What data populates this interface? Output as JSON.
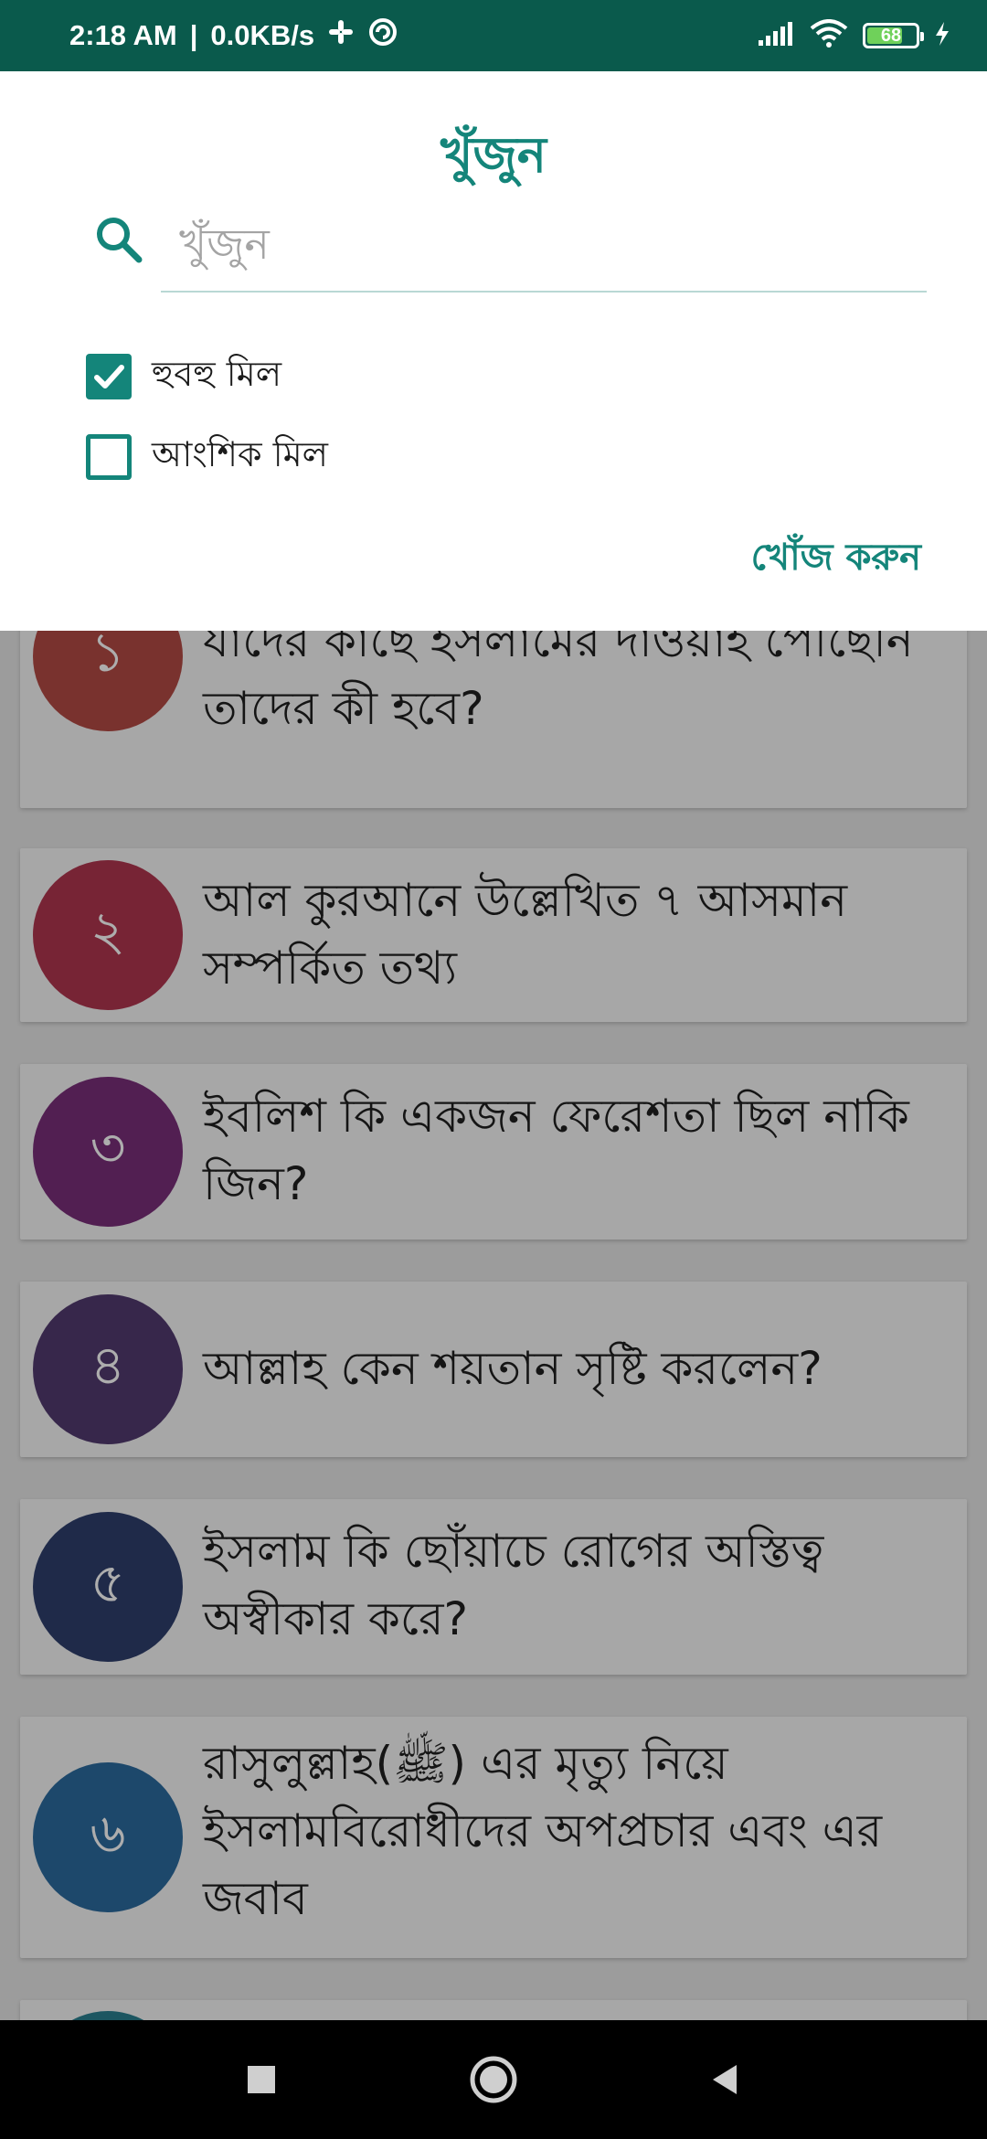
{
  "status_bar": {
    "time": "2:18 AM",
    "separator": "|",
    "network_speed": "0.0KB/s",
    "battery_level": "68",
    "icons": [
      "slack-icon",
      "sync-icon",
      "signal-icon",
      "wifi-icon",
      "battery-icon",
      "charging-icon"
    ]
  },
  "dialog": {
    "title": "খুঁজুন",
    "search_placeholder": "খুঁজুন",
    "search_value": "",
    "options": [
      {
        "label": "হুবহু মিল",
        "checked": true
      },
      {
        "label": "আংশিক মিল",
        "checked": false
      }
    ],
    "submit_label": "খোঁজ করুন"
  },
  "list": {
    "items": [
      {
        "number": "১",
        "title": "যারা কখনো ইসলামের নাম শোনেনি বা যাদের কাছে ইসলামের দাওয়াহ পৌঁছেনি তাদের কী হবে?",
        "color": "#b34a45"
      },
      {
        "number": "২",
        "title": "আল কুরআনে উল্লেখিত ৭ আসমান সম্পর্কিত তথ্য",
        "color": "#b0364f"
      },
      {
        "number": "৩",
        "title": "ইবলিশ কি একজন ফেরেশতা ছিল নাকি জিন?",
        "color": "#7a2f7a"
      },
      {
        "number": "৪",
        "title": "আল্লাহ কেন শয়তান সৃষ্টি করলেন?",
        "color": "#523a6f"
      },
      {
        "number": "৫",
        "title": "ইসলাম কি ছোঁয়াচে রোগের অস্তিত্ব অস্বীকার করে?",
        "color": "#2e3f6c"
      },
      {
        "number": "৬",
        "title": "রাসুলুল্লাহ(ﷺ) এর মৃত্যু নিয়ে ইসলামবিরোধীদের অপপ্রচার এবং এর জবাব",
        "color": "#2c6a9e"
      }
    ]
  },
  "nav_bar": {
    "buttons": [
      "recents-button",
      "home-button",
      "back-button"
    ]
  },
  "colors": {
    "accent": "#14857a",
    "status_bar": "#0a5a4c"
  }
}
